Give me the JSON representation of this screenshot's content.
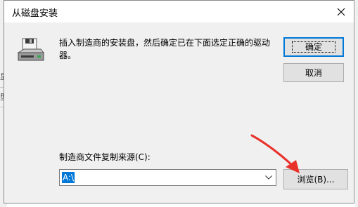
{
  "background": {
    "left_fragments": [
      "显",
      "型"
    ]
  },
  "dialog": {
    "title": "从磁盘安装",
    "message": "插入制造商的安装盘，然后确定已在下面选定正确的驱动器。",
    "ok_label": "确定",
    "cancel_label": "取消",
    "source_label": "制造商文件复制来源(C):",
    "source_value": "A:\\",
    "browse_label": "浏览(B)..."
  },
  "annotation": {
    "arrow_color": "#e8312a"
  },
  "colors": {
    "accent": "#0078d7",
    "dialog_bg": "#f0f0f0"
  }
}
